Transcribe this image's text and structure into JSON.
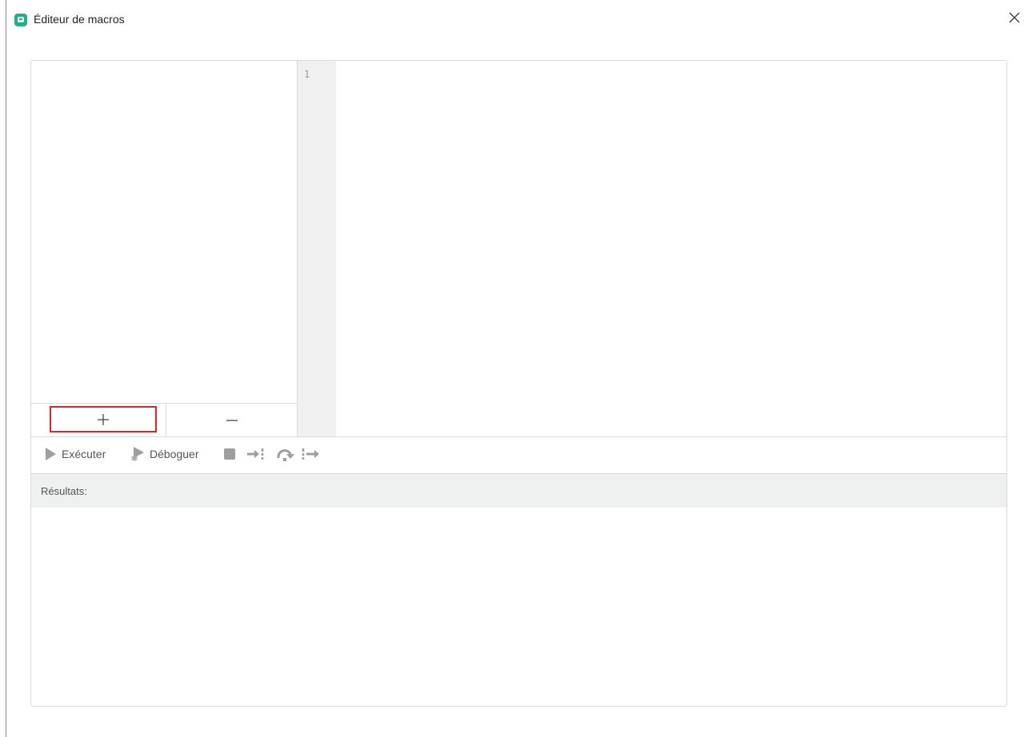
{
  "window": {
    "title": "Éditeur de macros"
  },
  "macro_list": {
    "items": [],
    "add_label": "+",
    "remove_label": "−"
  },
  "editor": {
    "line_numbers": [
      "1"
    ],
    "code": ""
  },
  "toolbar": {
    "run_label": "Exécuter",
    "debug_label": "Déboguer"
  },
  "results": {
    "label": "Résultats:"
  },
  "colors": {
    "accent": "#21b08a",
    "highlight": "#e0242b",
    "icon_gray": "#9e9e9e"
  }
}
